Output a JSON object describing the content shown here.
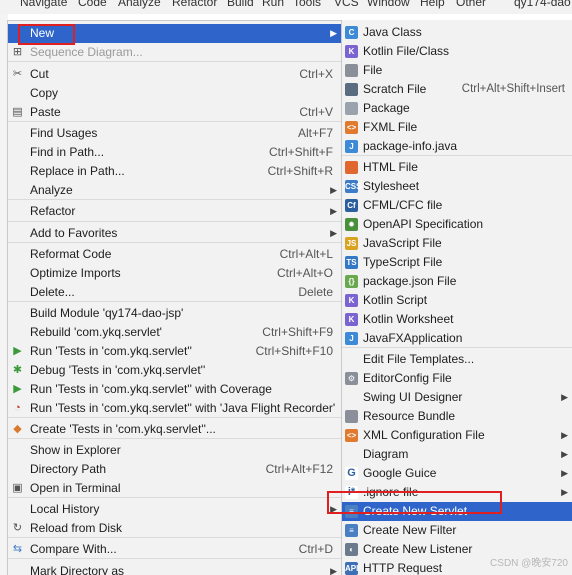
{
  "menubar": [
    "Navigate",
    "Code",
    "Analyze",
    "Refactor",
    "Build",
    "Run",
    "Tools",
    "VCS",
    "Window",
    "Help",
    "Other",
    "qy174-dao"
  ],
  "context_menu": {
    "items": [
      {
        "label": "New",
        "arrow": true,
        "selected": true,
        "icon": "none"
      },
      {
        "label": "Sequence Diagram...",
        "disabled": true,
        "icon": "diagram-icon"
      },
      {
        "label": "Cut",
        "shortcut": "Ctrl+X",
        "icon": "scissors-icon"
      },
      {
        "label": "Copy",
        "icon": "none"
      },
      {
        "label": "Paste",
        "shortcut": "Ctrl+V",
        "icon": "clipboard-icon"
      },
      {
        "label": "Find Usages",
        "shortcut": "Alt+F7"
      },
      {
        "label": "Find in Path...",
        "shortcut": "Ctrl+Shift+F"
      },
      {
        "label": "Replace in Path...",
        "shortcut": "Ctrl+Shift+R"
      },
      {
        "label": "Analyze",
        "arrow": true
      },
      {
        "label": "Refactor",
        "arrow": true
      },
      {
        "label": "Add to Favorites",
        "arrow": true
      },
      {
        "label": "Reformat Code",
        "shortcut": "Ctrl+Alt+L"
      },
      {
        "label": "Optimize Imports",
        "shortcut": "Ctrl+Alt+O"
      },
      {
        "label": "Delete...",
        "shortcut": "Delete"
      },
      {
        "label": "Build Module 'qy174-dao-jsp'"
      },
      {
        "label": "Rebuild 'com.ykq.servlet'",
        "shortcut": "Ctrl+Shift+F9"
      },
      {
        "label": "Run 'Tests in 'com.ykq.servlet''",
        "shortcut": "Ctrl+Shift+F10",
        "icon": "run-icon"
      },
      {
        "label": "Debug 'Tests in 'com.ykq.servlet''",
        "icon": "debug-icon"
      },
      {
        "label": "Run 'Tests in 'com.ykq.servlet'' with Coverage",
        "icon": "coverage-icon"
      },
      {
        "label": "Run 'Tests in 'com.ykq.servlet'' with 'Java Flight Recorder'",
        "icon": "profiler-icon"
      },
      {
        "label": "Create 'Tests in 'com.ykq.servlet''...",
        "icon": "create-test-icon"
      },
      {
        "label": "Show in Explorer"
      },
      {
        "label": "Directory Path",
        "shortcut": "Ctrl+Alt+F12"
      },
      {
        "label": "Open in Terminal",
        "icon": "terminal-icon"
      },
      {
        "label": "Local History",
        "arrow": true
      },
      {
        "label": "Reload from Disk",
        "icon": "reload-icon"
      },
      {
        "label": "Compare With...",
        "shortcut": "Ctrl+D",
        "icon": "compare-icon"
      },
      {
        "label": "Mark Directory as",
        "arrow": true
      }
    ]
  },
  "submenu": {
    "items": [
      {
        "label": "Java Class",
        "icon": "java-class-icon",
        "color": "#3d8ad6",
        "glyph": "C"
      },
      {
        "label": "Kotlin File/Class",
        "icon": "kotlin-file-icon",
        "color": "#7b63d1",
        "glyph": "K"
      },
      {
        "label": "File",
        "icon": "file-icon",
        "color": "#8a8f99",
        "glyph": ""
      },
      {
        "label": "Scratch File",
        "shortcut": "Ctrl+Alt+Shift+Insert",
        "icon": "scratch-file-icon",
        "color": "#5b6b80",
        "glyph": ""
      },
      {
        "label": "Package",
        "icon": "package-icon",
        "color": "#9aa3ad",
        "glyph": ""
      },
      {
        "label": "FXML File",
        "icon": "fxml-file-icon",
        "color": "#e07a2e",
        "glyph": "<>"
      },
      {
        "label": "package-info.java",
        "icon": "package-info-icon",
        "color": "#3d8ad6",
        "glyph": "J"
      },
      {
        "label": "HTML File",
        "icon": "html-file-icon",
        "color": "#e0672e",
        "glyph": ""
      },
      {
        "label": "Stylesheet",
        "icon": "stylesheet-icon",
        "color": "#3d7cc9",
        "glyph": "CSS"
      },
      {
        "label": "CFML/CFC file",
        "icon": "cfml-icon",
        "color": "#2d5f9e",
        "glyph": "Cf"
      },
      {
        "label": "OpenAPI Specification",
        "icon": "openapi-icon",
        "color": "#4a8f3c",
        "glyph": "✹"
      },
      {
        "label": "JavaScript File",
        "icon": "javascript-file-icon",
        "color": "#d9a320",
        "glyph": "JS"
      },
      {
        "label": "TypeScript File",
        "icon": "typescript-file-icon",
        "color": "#3478c6",
        "glyph": "TS"
      },
      {
        "label": "package.json File",
        "icon": "package-json-icon",
        "color": "#6aa84f",
        "glyph": "{}"
      },
      {
        "label": "Kotlin Script",
        "icon": "kotlin-script-icon",
        "color": "#7b63d1",
        "glyph": "K"
      },
      {
        "label": "Kotlin Worksheet",
        "icon": "kotlin-worksheet-icon",
        "color": "#7b63d1",
        "glyph": "K"
      },
      {
        "label": "JavaFXApplication",
        "icon": "javafx-icon",
        "color": "#3d8ad6",
        "glyph": "J"
      },
      {
        "label": "Edit File Templates...",
        "icon": "none",
        "color": "",
        "glyph": ""
      },
      {
        "label": "EditorConfig File",
        "icon": "gear-icon",
        "color": "#8a8f99",
        "glyph": "⚙"
      },
      {
        "label": "Swing UI Designer",
        "arrow": true,
        "icon": "none",
        "color": "",
        "glyph": ""
      },
      {
        "label": "Resource Bundle",
        "icon": "resource-bundle-icon",
        "color": "#8a8f99",
        "glyph": ""
      },
      {
        "label": "XML Configuration File",
        "arrow": true,
        "icon": "xml-file-icon",
        "color": "#e07a2e",
        "glyph": "<>"
      },
      {
        "label": "Diagram",
        "arrow": true,
        "icon": "none",
        "color": "",
        "glyph": ""
      },
      {
        "label": "Google Guice",
        "arrow": true,
        "icon": "google-icon",
        "color": "#ffffff",
        "glyph": "G"
      },
      {
        "label": ".ignore file",
        "arrow": true,
        "icon": "ignore-file-icon",
        "color": "#ffffff",
        "glyph": "i*"
      },
      {
        "label": "Create New Servlet",
        "selected": true,
        "icon": "servlet-icon",
        "color": "#4a7fc1",
        "glyph": "≡"
      },
      {
        "label": "Create New Filter",
        "icon": "filter-icon",
        "color": "#4a7fc1",
        "glyph": "≡"
      },
      {
        "label": "Create New Listener",
        "icon": "listener-icon",
        "color": "#6b7a8c",
        "glyph": "◐"
      },
      {
        "label": "HTTP Request",
        "icon": "http-request-icon",
        "color": "#3d6fb6",
        "glyph": "API"
      }
    ]
  },
  "watermark": "CSDN @晚安720"
}
